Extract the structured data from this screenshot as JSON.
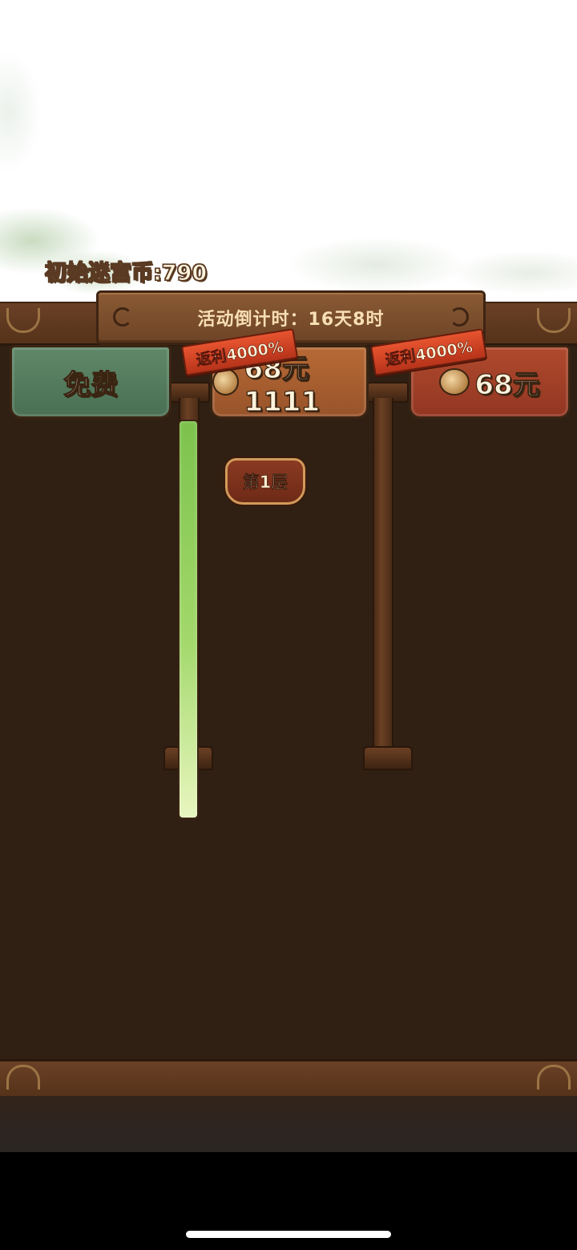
{
  "header": {
    "coins_label": "初始迷宫币:790",
    "countdown": "活动倒计时：16天8时"
  },
  "tabs": [
    {
      "label": "免费"
    },
    {
      "label": "68元1111",
      "ribbon": "返利4000%"
    },
    {
      "label": "68元",
      "ribbon": "返利4000%"
    }
  ],
  "progress": {
    "fraction": 1.0,
    "floor_label": "第1层"
  },
  "colors": {
    "board": "#2f2013",
    "tab_free": "#5a8263",
    "tab_68a": "#a85f30",
    "tab_68b": "#a2412a",
    "progress": "#9ad462"
  },
  "icons": [
    "coin-icon"
  ]
}
